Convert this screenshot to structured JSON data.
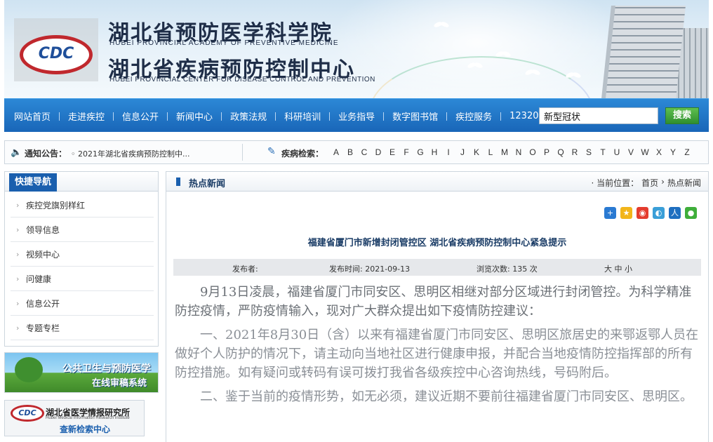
{
  "header": {
    "logo_text": "CDC",
    "title_cn_1": "湖北省预防医学科学院",
    "title_en_1": "HUBEI PROVINCIAL ACADEMY OF PREVENTIVE MEDICINE",
    "title_cn_2": "湖北省疾病预防控制中心",
    "title_en_2": "HUBEI PROVINCIAL CENTER FOR DISEASE CONTROL AND PREVENTION"
  },
  "nav": {
    "items": [
      "网站首页",
      "走进疾控",
      "信息公开",
      "新闻中心",
      "政策法规",
      "科研培训",
      "业务指导",
      "数字图书馆",
      "疾控服务",
      "12320"
    ],
    "search_value": "新型冠状",
    "search_button": "搜索"
  },
  "notice": {
    "label": "通知公告：",
    "text": "◦ 2021年湖北省疾病预防控制中...",
    "disease_label": "疾病检索：",
    "letters": [
      "A",
      "B",
      "C",
      "D",
      "E",
      "F",
      "G",
      "H",
      "I",
      "J",
      "K",
      "L",
      "M",
      "N",
      "O",
      "P",
      "Q",
      "R",
      "S",
      "T",
      "U",
      "V",
      "W",
      "X",
      "Y",
      "Z"
    ]
  },
  "sidebar": {
    "title": "快捷导航",
    "items": [
      "疾控党旗别样红",
      "领导信息",
      "视频中心",
      "问健康",
      "信息公开",
      "专题专栏"
    ]
  },
  "ads": {
    "ad1_line1": "公共卫生与预防医学",
    "ad1_line2": "在线审稿系统",
    "ad2_logo": "CDC",
    "ad2_line1": "湖北省医学情报研究所",
    "ad2_line2": "Hubei Medical Information Research Institute",
    "ad2_line3": "查新检索中心"
  },
  "main": {
    "section_title": "热点新闻",
    "breadcrumb": {
      "prefix": "· 当前位置：",
      "home": "首页",
      "sep": "›",
      "current": "热点新闻"
    },
    "share_icons": [
      "share-add-icon",
      "qzone-icon",
      "weibo-icon",
      "tencent-weibo-icon",
      "renren-icon",
      "wechat-icon"
    ],
    "article": {
      "title": "福建省厦门市新增封闭管控区  湖北省疾病预防控制中心紧急提示",
      "publisher_label": "发布者:",
      "date_label": "发布时间: 2021-09-13",
      "views_label": "浏览次数: 135 次",
      "font_sizes": "大  中  小",
      "para1": "9月13日凌晨，福建省厦门市同安区、思明区相继对部分区域进行封闭管控。为科学精准防控疫情，严防疫情输入，现对广大群众提出如下疫情防控建议：",
      "para2": "一、2021年8月30日（含）以来有福建省厦门市同安区、思明区旅居史的来鄂返鄂人员在做好个人防护的情况下，请主动向当地社区进行健康申报，并配合当地疫情防控指挥部的所有防控措施。如有疑问或转码有误可拨打我省各级疾控中心咨询热线，号码附后。",
      "para3": "二、鉴于当前的疫情形势，如无必须，建议近期不要前往福建省厦门市同安区、思明区。"
    }
  },
  "colors": {
    "nav_blue": "#1966b8",
    "tab_blue": "#1a5fae",
    "logo_red": "#c0282d",
    "search_green": "#2f8f2f"
  }
}
